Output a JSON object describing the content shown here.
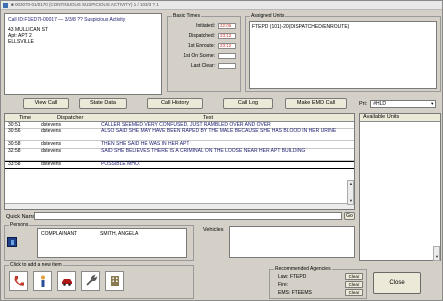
{
  "window": {
    "title": "■ 003070-01/0170 (CONTINUOUS SUSPICIOUS ACTIVITY) 1 / 103/3 ? 1"
  },
  "call": {
    "line1": "Call ID:F1ED7I-00017 — 3/3/8 ?? Suspicious Activity",
    "line2": "43 MULLICAN ST",
    "line3": "Apt: APT 2",
    "line4": "ELLSVILLE"
  },
  "basic_times": {
    "label": "Basic Times",
    "rows": [
      {
        "label": "Initiated:",
        "value": "22:06"
      },
      {
        "label": "Dispatched:",
        "value": "23:12"
      },
      {
        "label": "1st Enroute:",
        "value": "23:12"
      },
      {
        "label": "1st On Scene:",
        "value": ""
      },
      {
        "label": "Last Clear:",
        "value": ""
      }
    ]
  },
  "assigned_units": {
    "label": "Assigned Units",
    "text": "FTEPD (101)-20(DISPATCHED/ENROUTE)"
  },
  "buttons": {
    "view_call": "View Call",
    "state_data": "State Data",
    "call_history": "Call History",
    "call_log": "Call Log",
    "make_emd_call": "Make EMD Call",
    "go": "Go",
    "close": "Close"
  },
  "priority": {
    "label": "Pri:",
    "value": "#HLD"
  },
  "log": {
    "columns": [
      "Time",
      "Dispatcher",
      "Text"
    ],
    "rows": [
      {
        "time": "30:51",
        "dispatcher": "dstevens",
        "text": "CALLER SEEMED VERY CONFUSED, JUST RAMBLED OVER AND OVER"
      },
      {
        "time": "30:56",
        "dispatcher": "dstevens",
        "text": "ALSO SAID SHE MAY HAVE BEEN RAPED BY THE MALE BECAUSE SHE HAS BLOOD IN HER URINE"
      },
      {
        "time": "30:58",
        "dispatcher": "dstevens",
        "text": "THEN SHE SAID HE WAS IN HER APT"
      },
      {
        "time": "32:58",
        "dispatcher": "dstevens",
        "text": "SAID SHE BELIEVES THERE IS A CRIMINAL ON THE LOOSE NEAR HER APT BUILDING"
      },
      {
        "time": "33:58",
        "dispatcher": "dstevens",
        "text": "POSSIBLE MHO."
      }
    ]
  },
  "available_units": {
    "label": "Available Units"
  },
  "quick_narrative": {
    "label": "Quick Narrative:"
  },
  "persons": {
    "label": "Persons",
    "rows": [
      {
        "role": "COMPLAINANT",
        "name": "SMITH, ANGELA"
      }
    ]
  },
  "vehicles": {
    "label": "Vehicles"
  },
  "add_new": {
    "label": "Click to add a new item",
    "icons": [
      "phone-icon",
      "person-icon",
      "vehicle-icon",
      "wrench-icon",
      "building-icon"
    ]
  },
  "recommended_agencies": {
    "label": "Recommended Agencies",
    "rows": [
      {
        "label": "Law: FTEPD",
        "button": "Clear"
      },
      {
        "label": "Fire:",
        "button": "Clear"
      },
      {
        "label": "EMS: FTEEMS",
        "button": "Clear"
      }
    ]
  }
}
